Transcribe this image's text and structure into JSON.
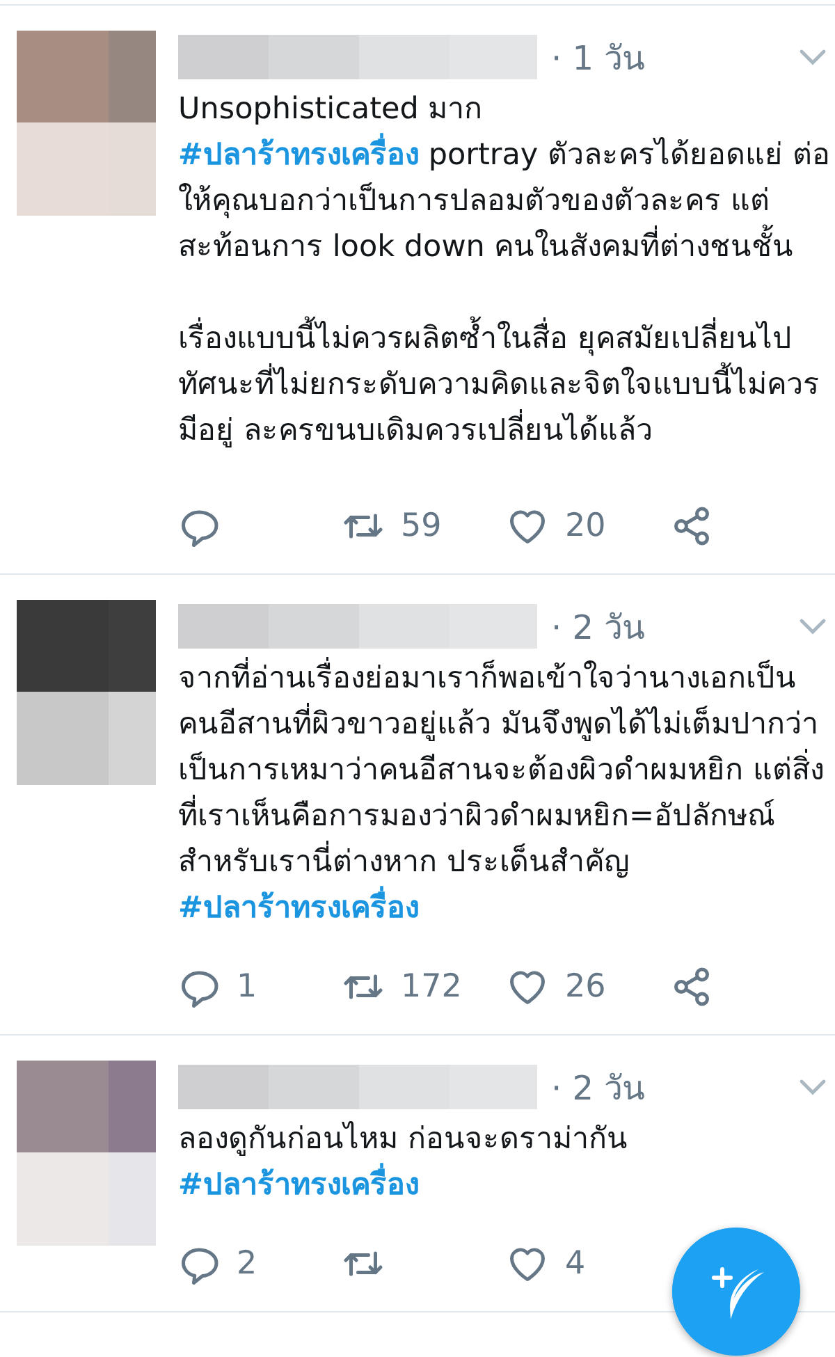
{
  "tweets": [
    {
      "time": "· 1 วัน",
      "body": [
        {
          "kind": "text",
          "text": "Unsophisticated มาก\n"
        },
        {
          "kind": "hashtag",
          "text": "#ปลาร้าทรงเครื่อง"
        },
        {
          "kind": "text",
          "text": " portray ตัวละครได้ยอดแย่ ต่อให้คุณบอกว่าเป็นการปลอมตัวของตัวละคร แต่สะท้อนการ look down คนในสังคมที่ต่างชนชั้น\n\nเรื่องแบบนี้ไม่ควรผลิตซ้ำในสื่อ ยุคสมัยเปลี่ยนไป ทัศนะที่ไม่ยกระดับความคิดและจิตใจแบบนี้ไม่ควรมีอยู่ ละครขนบเดิมควรเปลี่ยนได้แล้ว"
        }
      ],
      "actions": [
        {
          "kind": "reply"
        },
        {
          "kind": "retweet",
          "count": "59"
        },
        {
          "kind": "like",
          "count": "20"
        },
        {
          "kind": "share"
        }
      ]
    },
    {
      "time": "· 2 วัน",
      "body": [
        {
          "kind": "text",
          "text": "จากที่อ่านเรื่องย่อมาเราก็พอเข้าใจว่านางเอกเป็นคนอีสานที่ผิวขาวอยู่แล้ว มันจึงพูดได้ไม่เต็มปากว่าเป็นการเหมาว่าคนอีสานจะต้องผิวดำผมหยิก แต่สิ่งที่เราเห็นคือการมองว่าผิวดำผมหยิก=อัปลักษณ์ สำหรับเรานี่ต่างหาก ประเด็นสำคัญ "
        },
        {
          "kind": "hashtag",
          "text": "#ปลาร้าทรงเครื่อง"
        }
      ],
      "actions": [
        {
          "kind": "reply",
          "count": "1"
        },
        {
          "kind": "retweet",
          "count": "172"
        },
        {
          "kind": "like",
          "count": "26"
        },
        {
          "kind": "share"
        }
      ]
    },
    {
      "time": "· 2 วัน",
      "body": [
        {
          "kind": "text",
          "text": "ลองดูกันก่อนไหม ก่อนจะดราม่ากัน "
        },
        {
          "kind": "hashtag",
          "text": "#ปลาร้าทรงเครื่อง"
        }
      ],
      "actions": [
        {
          "kind": "reply",
          "count": "2"
        },
        {
          "kind": "retweet"
        },
        {
          "kind": "like",
          "count": "4"
        }
      ]
    }
  ]
}
